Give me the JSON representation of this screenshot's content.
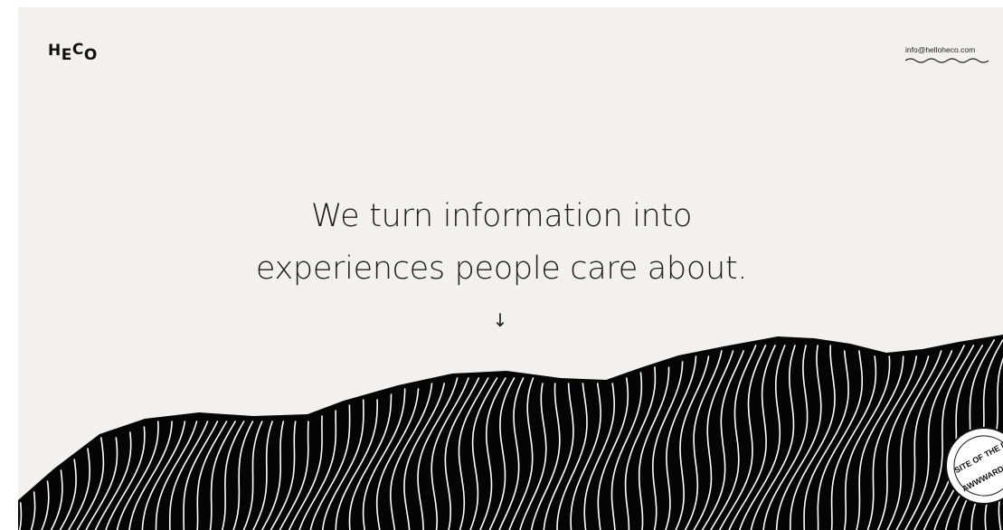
{
  "brand": {
    "logo_letters": [
      "H",
      "E",
      "C",
      "O"
    ]
  },
  "header": {
    "contact_email": "info@helloheco.com"
  },
  "hero": {
    "headline_line1": "We turn information into",
    "headline_line2": "experiences people care about.",
    "scroll_arrow": "↓"
  },
  "badge": {
    "text_top": "SITE OF THE DAY",
    "text_bottom": "AWWWARDS",
    "icon": "awwwards-badge-icon"
  },
  "colors": {
    "page_background": "#f3f1ee",
    "outer_background": "#ffffff",
    "text": "#1d1d1d",
    "terrain": "#050505",
    "terrain_lines": "#ffffff"
  }
}
